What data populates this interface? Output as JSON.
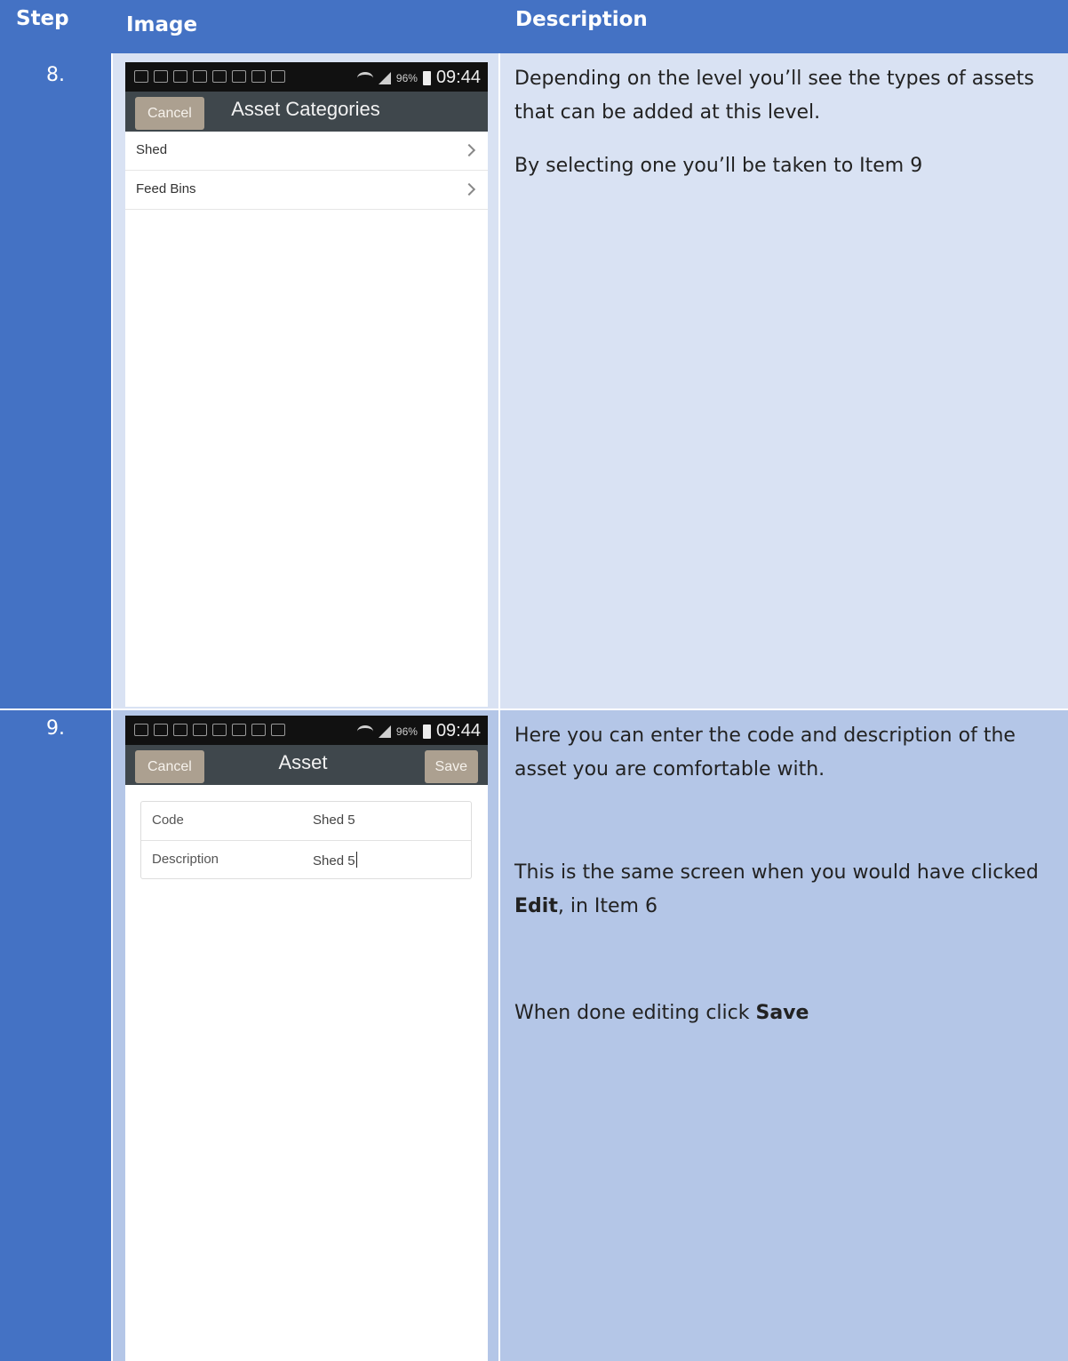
{
  "table": {
    "headers": {
      "step": "Step",
      "image": "Image",
      "description": "Description"
    }
  },
  "colors": {
    "header_bg": "#4472c4",
    "row1_bg": "#d9e2f3",
    "row2_bg": "#b4c6e7",
    "app_bar": "#3f474c",
    "button_bg": "#aca090"
  },
  "rows": [
    {
      "step": "8.",
      "phone": {
        "status": {
          "battery_pct": "96%",
          "time": "09:44"
        },
        "nav": {
          "cancel": "Cancel",
          "title": "Asset Categories"
        },
        "list": [
          {
            "label": "Shed",
            "icon": "chevron-right-icon"
          },
          {
            "label": "Feed Bins",
            "icon": "chevron-right-icon"
          }
        ]
      },
      "desc": {
        "p1": "Depending on the level you’ll see the types of assets that can be added at this level.",
        "p2": "By selecting one you’ll be taken to Item 9"
      }
    },
    {
      "step": "9.",
      "phone": {
        "status": {
          "battery_pct": "96%",
          "time": "09:44"
        },
        "nav": {
          "cancel": "Cancel",
          "title": "Asset",
          "save": "Save"
        },
        "form": [
          {
            "label": "Code",
            "value": "Shed 5"
          },
          {
            "label": "Description",
            "value": "Shed 5"
          }
        ]
      },
      "desc": {
        "p1": "Here you can enter the code and description of the asset you are comfortable with.",
        "p2_pre": "This is the same screen when you would have clicked ",
        "p2_bold": "Edit",
        "p2_post": ", in Item 6",
        "p3_pre": "When done editing click ",
        "p3_bold": "Save"
      }
    }
  ]
}
